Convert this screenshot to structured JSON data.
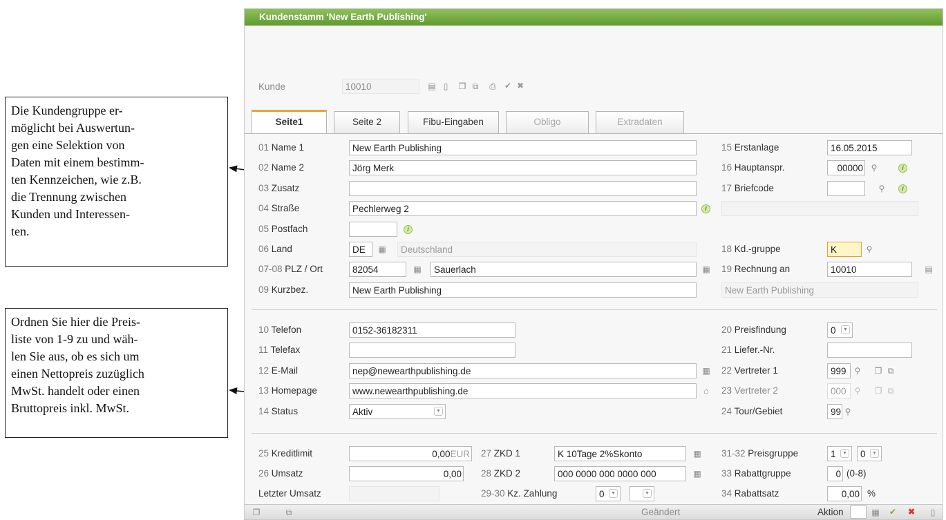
{
  "callouts": {
    "first": "Die Kundengruppe er-\nmöglicht bei Auswertun-\ngen eine Selektion von\nDaten mit einem bestimm-\nten Kennzeichen, wie z.B.\ndie Trennung zwischen\nKunden und Interessen-\nten.",
    "second": "Ordnen Sie hier die Preis-\nliste von 1-9 zu und wäh-\nlen Sie aus, ob es sich um\neinen Nettopreis zuzüglich\nMwSt. handelt oder einen\nBruttopreis inkl. MwSt."
  },
  "window": {
    "title": "Kundenstamm  'New Earth Publishing'"
  },
  "kunde": {
    "label": "Kunde",
    "value": "10010"
  },
  "tabs": [
    {
      "label": "Seite1"
    },
    {
      "label": "Seite 2"
    },
    {
      "label": "Fibu-Eingaben"
    },
    {
      "label": "Obligo"
    },
    {
      "label": "Extradaten"
    }
  ],
  "left1": [
    {
      "num": "01",
      "label": "Name 1",
      "value": "New Earth Publishing"
    },
    {
      "num": "02",
      "label": "Name 2",
      "value": "Jörg Merk"
    },
    {
      "num": "03",
      "label": "Zusatz",
      "value": ""
    },
    {
      "num": "04",
      "label": "Straße",
      "value": "Pechlerweg 2"
    },
    {
      "num": "05",
      "label": "Postfach",
      "value": ""
    },
    {
      "num": "06",
      "label": "Land",
      "value": "DE",
      "extra": "Deutschland"
    },
    {
      "num": "07-08",
      "label": "PLZ / Ort",
      "value": "82054",
      "extra": "Sauerlach"
    },
    {
      "num": "09",
      "label": "Kurzbez.",
      "value": "New Earth Publishing"
    }
  ],
  "right1": {
    "erstanlage": {
      "num": "15",
      "label": "Erstanlage",
      "value": "16.05.2015"
    },
    "hauptanspr": {
      "num": "16",
      "label": "Hauptanspr.",
      "value": "00000"
    },
    "briefcode": {
      "num": "17",
      "label": "Briefcode",
      "value": ""
    },
    "kdgruppe": {
      "num": "18",
      "label": "Kd.-gruppe",
      "value": "K"
    },
    "rechnung": {
      "num": "19",
      "label": "Rechnung an",
      "value": "10010",
      "extra": "New Earth Publishing"
    }
  },
  "left2": [
    {
      "num": "10",
      "label": "Telefon",
      "value": "0152-36182311"
    },
    {
      "num": "11",
      "label": "Telefax",
      "value": ""
    },
    {
      "num": "12",
      "label": "E-Mail",
      "value": "nep@newearthpublishing.de"
    },
    {
      "num": "13",
      "label": "Homepage",
      "value": "www.newearthpublishing.de"
    },
    {
      "num": "14",
      "label": "Status",
      "value": "Aktiv"
    }
  ],
  "right2": {
    "preisfindung": {
      "num": "20",
      "label": "Preisfindung",
      "value": "0"
    },
    "liefernr": {
      "num": "21",
      "label": "Liefer.-Nr.",
      "value": ""
    },
    "vertreter1": {
      "num": "22",
      "label": "Vertreter 1",
      "value": "999"
    },
    "vertreter2": {
      "num": "23",
      "label": "Vertreter 2",
      "value": "000"
    },
    "tour": {
      "num": "24",
      "label": "Tour/Gebiet",
      "value": "99"
    }
  },
  "bottom": {
    "kreditlimit": {
      "num": "25",
      "label": "Kreditlimit",
      "value": "0,00",
      "unit": "EUR"
    },
    "umsatz": {
      "num": "26",
      "label": "Umsatz",
      "value": "0,00"
    },
    "letzter": {
      "label": "Letzter Umsatz",
      "value": ""
    },
    "zkd1": {
      "num": "27",
      "label": "ZKD 1",
      "value": "K 10Tage 2%Skonto"
    },
    "zkd2": {
      "num": "28",
      "label": "ZKD 2",
      "value": "000 0000 000 0000 000"
    },
    "kzzahlung": {
      "num": "29-30",
      "label": "Kz. Zahlung",
      "value1": "0",
      "value2": ""
    },
    "preisgruppe": {
      "num": "31-32",
      "label": "Preisgruppe",
      "value1": "1",
      "value2": "0"
    },
    "rabattgruppe": {
      "num": "33",
      "label": "Rabattgruppe",
      "value": "0",
      "hint": "(0-8)"
    },
    "rabattsatz": {
      "num": "34",
      "label": "Rabattsatz",
      "value": "0,00",
      "unit": "%"
    }
  },
  "status": {
    "changed": "Geändert",
    "aktion": "Aktion"
  }
}
